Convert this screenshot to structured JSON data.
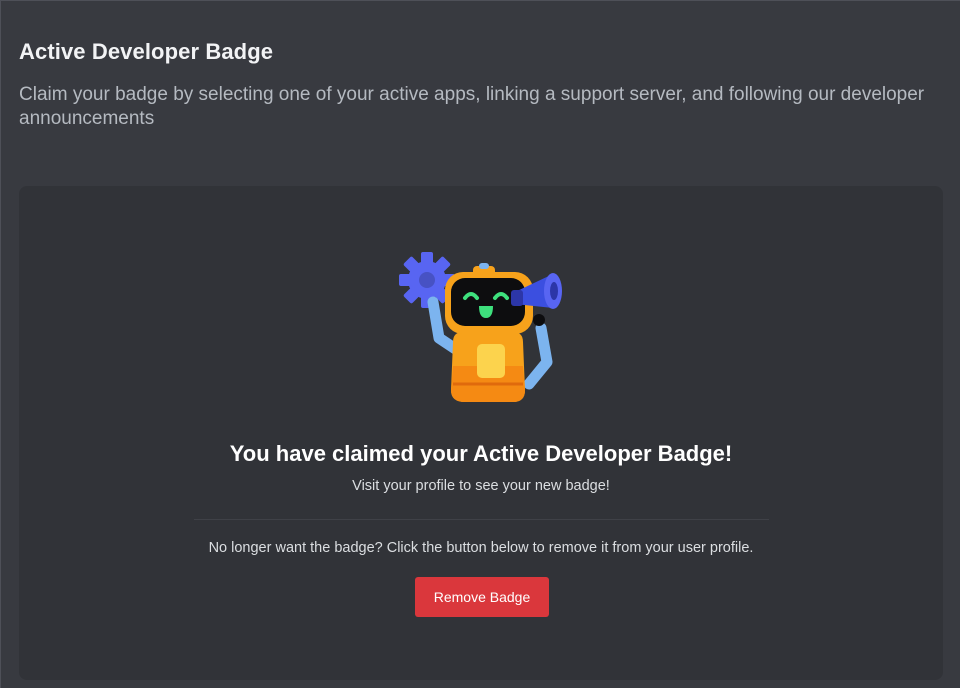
{
  "header": {
    "title": "Active Developer Badge",
    "subtitle": "Claim your badge by selecting one of your active apps, linking a support server, and following our developer announcements"
  },
  "card": {
    "mascot_icon": "robot-megaphone-mascot-icon",
    "claimed_title": "You have claimed your Active Developer Badge!",
    "claimed_subtitle": "Visit your profile to see your new badge!",
    "remove_prompt": "No longer want the badge? Click the button below to remove it from your user profile.",
    "remove_button_label": "Remove Badge"
  },
  "colors": {
    "background": "#383a40",
    "card": "#313338",
    "danger": "#da373c",
    "mascot_orange": "#f7a21b",
    "mascot_blue": "#5865f2"
  }
}
